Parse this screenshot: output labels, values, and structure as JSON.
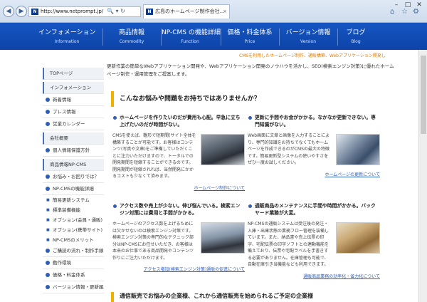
{
  "browser": {
    "back_glyph": "◀",
    "forward_glyph": "▶",
    "url": "http://www.netprompt.jp/",
    "addr_tools": "🔍 ▾ ↻",
    "tab_title": "広島のホームページ制作会社...",
    "tab_close": "×",
    "favicon_text": "N",
    "win_min": "–",
    "win_max": "□",
    "win_close": "✕",
    "home_glyph": "⌂",
    "star_glyph": "☆",
    "gear_glyph": "⚙"
  },
  "nav": [
    {
      "title": "インフォメーション",
      "sub": "Information"
    },
    {
      "title": "商品情報",
      "sub": "Commodity"
    },
    {
      "title": "NP-CMS の機能詳細",
      "sub": "Function"
    },
    {
      "title": "価格・料金体系",
      "sub": "Price"
    },
    {
      "title": "バージョン情報",
      "sub": "Version"
    },
    {
      "title": "ブログ",
      "sub": "Blog"
    }
  ],
  "tagline": "CMSを利用したホームページ制作、通販構築、Webアプリケーション開発し",
  "intro": "更新作業の簡単なWebアプリケーション開発や、Webアプリケーション開発のノウハウを活かし、SEO(検索エンジン対策)に優れたホームページ制作・運用管理をご提案します。",
  "sidebar": [
    {
      "label": "TOPページ",
      "kind": "head"
    },
    {
      "label": "インフォメーション",
      "kind": "head"
    },
    {
      "label": "新着情報",
      "kind": "bullet"
    },
    {
      "label": "プレス情報",
      "kind": "bullet"
    },
    {
      "label": "営業カレンダー",
      "kind": "bullet"
    },
    {
      "label": "会社概要",
      "kind": "head"
    },
    {
      "label": "個人情報保護方針",
      "kind": "bullet"
    },
    {
      "label": "商品情報NP-CMS",
      "kind": "head"
    },
    {
      "label": "お悩み・お困りでは？",
      "kind": "bullet"
    },
    {
      "label": "NP-CMSの機能詳細",
      "kind": "bullet"
    },
    {
      "label": "簡易更新システム",
      "kind": "sub"
    },
    {
      "label": "標準装備機能",
      "kind": "sub"
    },
    {
      "label": "オプション(会員・通販)",
      "kind": "sub"
    },
    {
      "label": "オプション(携帯サイト)",
      "kind": "sub"
    },
    {
      "label": "NP-CMSのメリット",
      "kind": "sub"
    },
    {
      "label": "ご購読の流れ・制作手順",
      "kind": "bullet"
    },
    {
      "label": "動作環境",
      "kind": "bullet"
    },
    {
      "label": "価格・料金体系",
      "kind": "bullet"
    },
    {
      "label": "バージョン情報・更新履歴",
      "kind": "bullet"
    }
  ],
  "section_title": "こんなお悩みや問題をお持ちではありませんか？",
  "cards": [
    {
      "title": "ホームページを作りたいのだが費用も心配。早急に立ち上げたいのだが時間がない。",
      "text": "CMSを使えば、雛形で短期間(サイト全体を構築することが可能です。お客様はコンテンツ(写真や文章)をご準備していただくことに注力いただけますので、トータルでの開発期間を短縮することができるのです。開発期間が短縮されれば、当然開発にかかるコストも少なくて済みます。",
      "link": "ホームページ制作について"
    },
    {
      "title": "更新に手間やお金がかかる。なかなか更新できない。専門知識がない。",
      "text": "Web画面に文章と画像を入力することにより、専門的知識をお持ちでなくてもホームページを作成できるのがCMSの最大の特徴です。簡易更新型システムの使いやすさをぜひ一度お試しください。",
      "link": "ホームページの更新について"
    },
    {
      "title": "アクセス数や売上が少ない。伸び悩んでいる。検索エンジン対策には費用と手間がかかる。",
      "text": "ホームページのアクセス数を上げるためには欠かせないのは検索エンジン対策です。検索エンジン対策の専門的なテクニック部分はNP-CMSにお任せいただき、お客様は本来のお仕事である商品開発やコンテンツ作りにご注力いただけます。",
      "link": "アクセス増加(検索エンジン対策)通販の促進について"
    },
    {
      "title": "通販商品のメンテナンスに手間や時間がかかる。バックヤード業務が大変。",
      "text": "NP-CMSの通販システムは受注後の発注・入庫・出庫状態の業務フロー管理を装備しています。また、納品書や売上伝票の印字、宅配伝票の印字ソフトとの連動機能を備えており、伝票や宅配ラベルを手書きする必要がありません。在庫管理も可能で、自動在庫引き当機能なども利用できます。",
      "link": "通販商品業務の効率化・省力化について"
    }
  ],
  "bottom_heading": "通信販売でお悩みの企業様、これから通信販売を始められるご予定の企業様"
}
